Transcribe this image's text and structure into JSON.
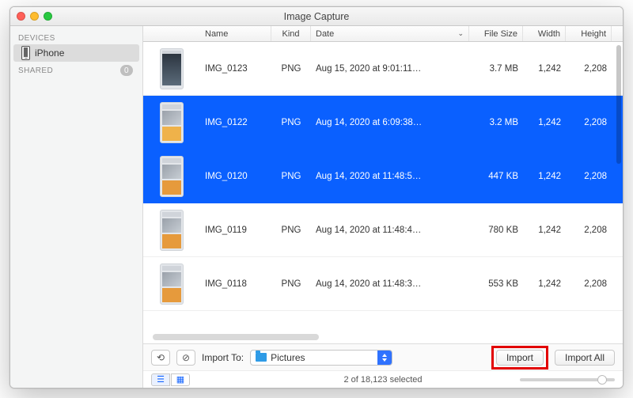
{
  "window": {
    "title": "Image Capture"
  },
  "sidebar": {
    "sections": {
      "devices_header": "DEVICES",
      "shared_header": "SHARED",
      "shared_badge": "0"
    },
    "device": {
      "label": "iPhone"
    }
  },
  "columns": {
    "name": "Name",
    "kind": "Kind",
    "date": "Date",
    "size": "File Size",
    "width": "Width",
    "height": "Height"
  },
  "rows": [
    {
      "name": "IMG_0123",
      "kind": "PNG",
      "date": "Aug 15, 2020 at 9:01:11…",
      "size": "3.7 MB",
      "width": "1,242",
      "height": "2,208",
      "selected": false,
      "thumb": "photo"
    },
    {
      "name": "IMG_0122",
      "kind": "PNG",
      "date": "Aug 14, 2020 at 6:09:38…",
      "size": "3.2 MB",
      "width": "1,242",
      "height": "2,208",
      "selected": true,
      "thumb": "settings"
    },
    {
      "name": "IMG_0120",
      "kind": "PNG",
      "date": "Aug 14, 2020 at 11:48:5…",
      "size": "447 KB",
      "width": "1,242",
      "height": "2,208",
      "selected": true,
      "thumb": "list"
    },
    {
      "name": "IMG_0119",
      "kind": "PNG",
      "date": "Aug 14, 2020 at 11:48:4…",
      "size": "780 KB",
      "width": "1,242",
      "height": "2,208",
      "selected": false,
      "thumb": "list"
    },
    {
      "name": "IMG_0118",
      "kind": "PNG",
      "date": "Aug 14, 2020 at 11:48:3…",
      "size": "553 KB",
      "width": "1,242",
      "height": "2,208",
      "selected": false,
      "thumb": "list"
    }
  ],
  "toolbar": {
    "import_to_label": "Import To:",
    "destination": "Pictures",
    "import_label": "Import",
    "import_all_label": "Import All"
  },
  "footer": {
    "status": "2 of 18,123 selected"
  }
}
